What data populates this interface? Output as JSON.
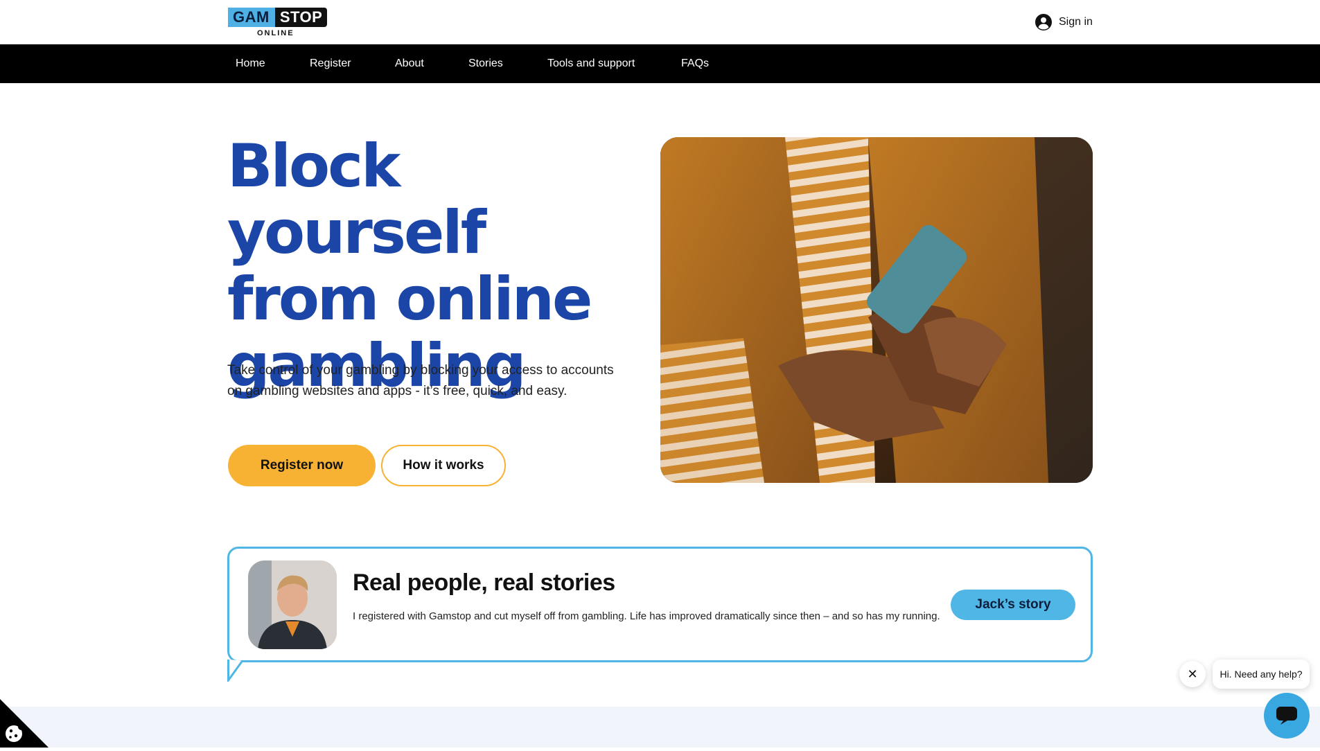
{
  "header": {
    "logo": {
      "part1": "GAM",
      "part2": "STOP",
      "sub": "ONLINE"
    },
    "signin_label": "Sign in"
  },
  "nav": {
    "items": [
      {
        "label": "Home"
      },
      {
        "label": "Register"
      },
      {
        "label": "About"
      },
      {
        "label": "Stories"
      },
      {
        "label": "Tools and support"
      },
      {
        "label": "FAQs"
      }
    ]
  },
  "hero": {
    "title_lines": [
      "Block yourself",
      "from online",
      "gambling"
    ],
    "description": "Take control of your gambling by blocking your access to accounts on gambling websites and apps - it’s free, quick, and easy.",
    "primary_button": "Register now",
    "secondary_button": "How it works"
  },
  "story": {
    "title": "Real people, real stories",
    "text": "I registered with Gamstop and cut myself off from gambling. Life has improved dramatically since then – and so has my running.",
    "button": "Jack’s story"
  },
  "chat": {
    "greeting": "Hi. Need any help?",
    "close_glyph": "✕"
  },
  "colors": {
    "brand_blue": "#1b46a8",
    "accent_orange": "#f7b233",
    "accent_light_blue": "#4fb6e6",
    "nav_bg": "#000000"
  }
}
